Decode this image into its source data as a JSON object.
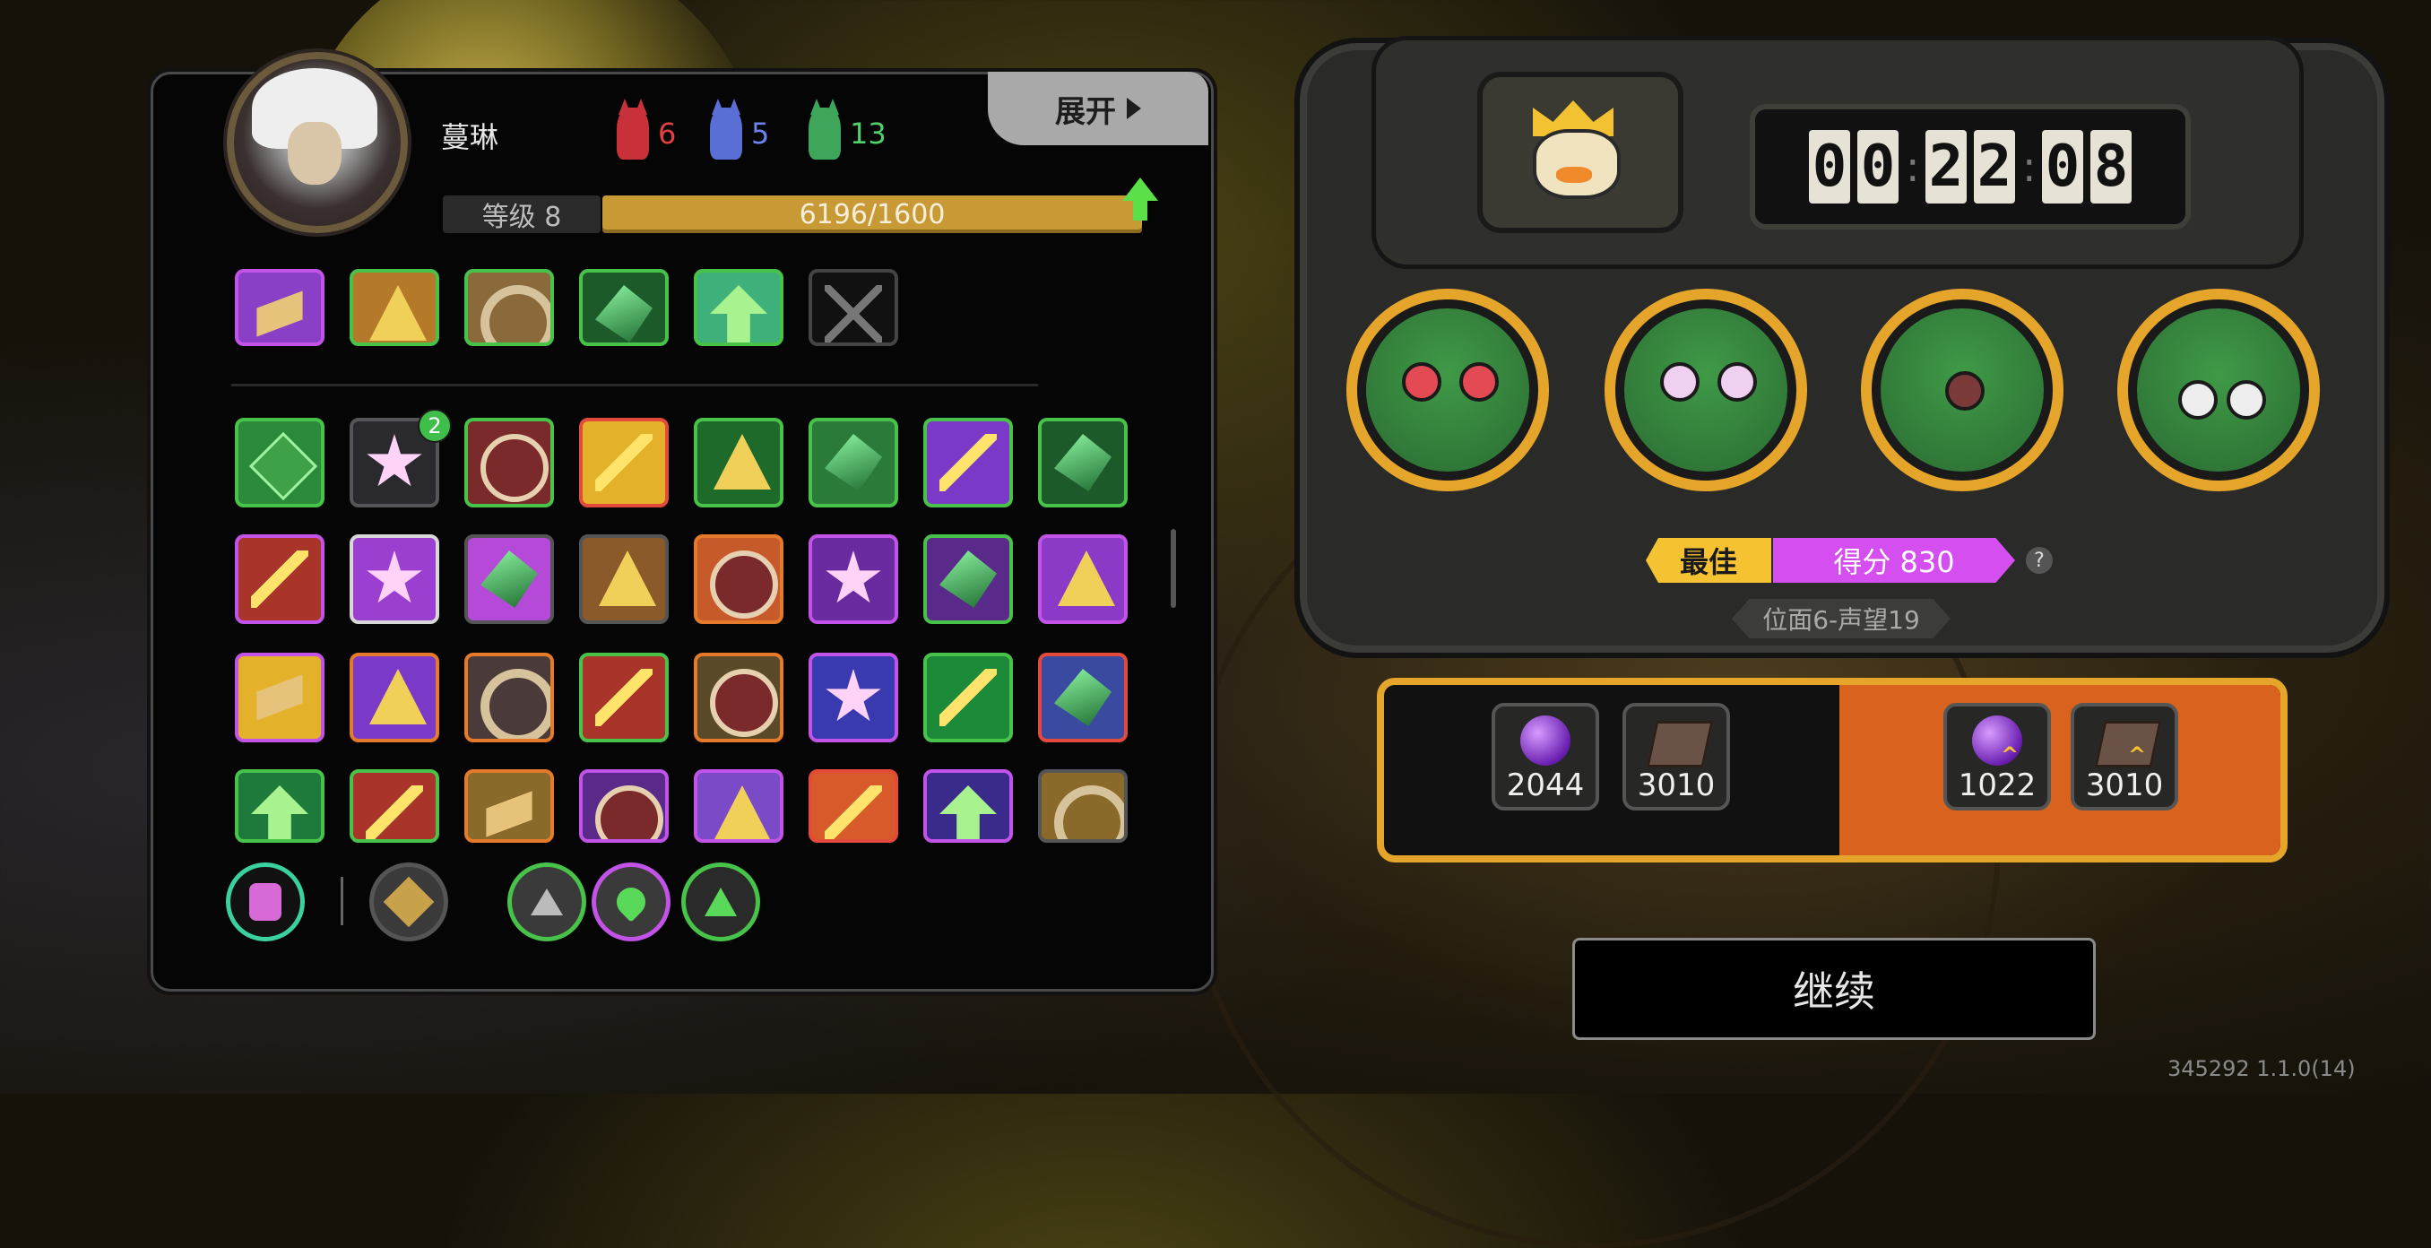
{
  "player": {
    "name": "蔓琳",
    "level_label": "等级 8",
    "xp_text": "6196/1600"
  },
  "resources": [
    {
      "name": "red-crystal-icon",
      "value": "6",
      "color": "#e0413f"
    },
    {
      "name": "blue-crystal-icon",
      "value": "5",
      "color": "#6d83ee"
    },
    {
      "name": "green-crystal-icon",
      "value": "13",
      "color": "#4fd36a"
    }
  ],
  "expand_label": "展开",
  "slot_badge": "2",
  "timer": {
    "digits": [
      "0",
      "0",
      "2",
      "2",
      "0",
      "8"
    ]
  },
  "result": {
    "best_label": "最佳",
    "score_label": "得分 830",
    "help_icon": "?",
    "realm_label": "位面6-声望19"
  },
  "rewards": [
    {
      "icon": "purple-orb-icon",
      "value": "2044"
    },
    {
      "icon": "book-icon",
      "value": "3010"
    },
    {
      "icon": "purple-orb-icon",
      "value": "1022"
    },
    {
      "icon": "book-icon",
      "value": "3010"
    }
  ],
  "continue_label": "继续",
  "version": "345292 1.1.0(14)",
  "colors": {
    "accent_gold": "#e4a52a",
    "accent_orange": "#d9621f",
    "score_purple": "#d54ef0"
  }
}
